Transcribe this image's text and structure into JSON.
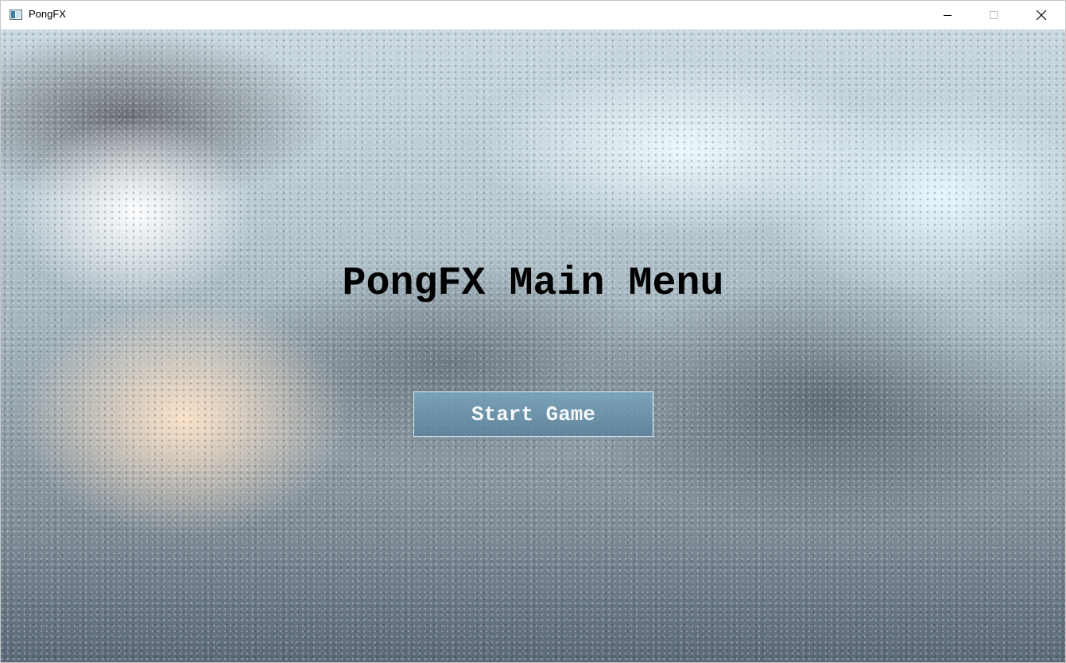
{
  "window": {
    "title": "PongFX",
    "app_icon": "app-window-icon",
    "controls": {
      "minimize_icon": "minimize-icon",
      "maximize_icon": "maximize-icon",
      "close_icon": "close-icon"
    }
  },
  "menu": {
    "heading": "PongFX Main Menu",
    "start_button_label": "Start Game",
    "colors": {
      "heading": "#000000",
      "button_text": "#f4f8fa",
      "button_fill": "#6e96ae",
      "button_border": "#d8eef6"
    }
  }
}
